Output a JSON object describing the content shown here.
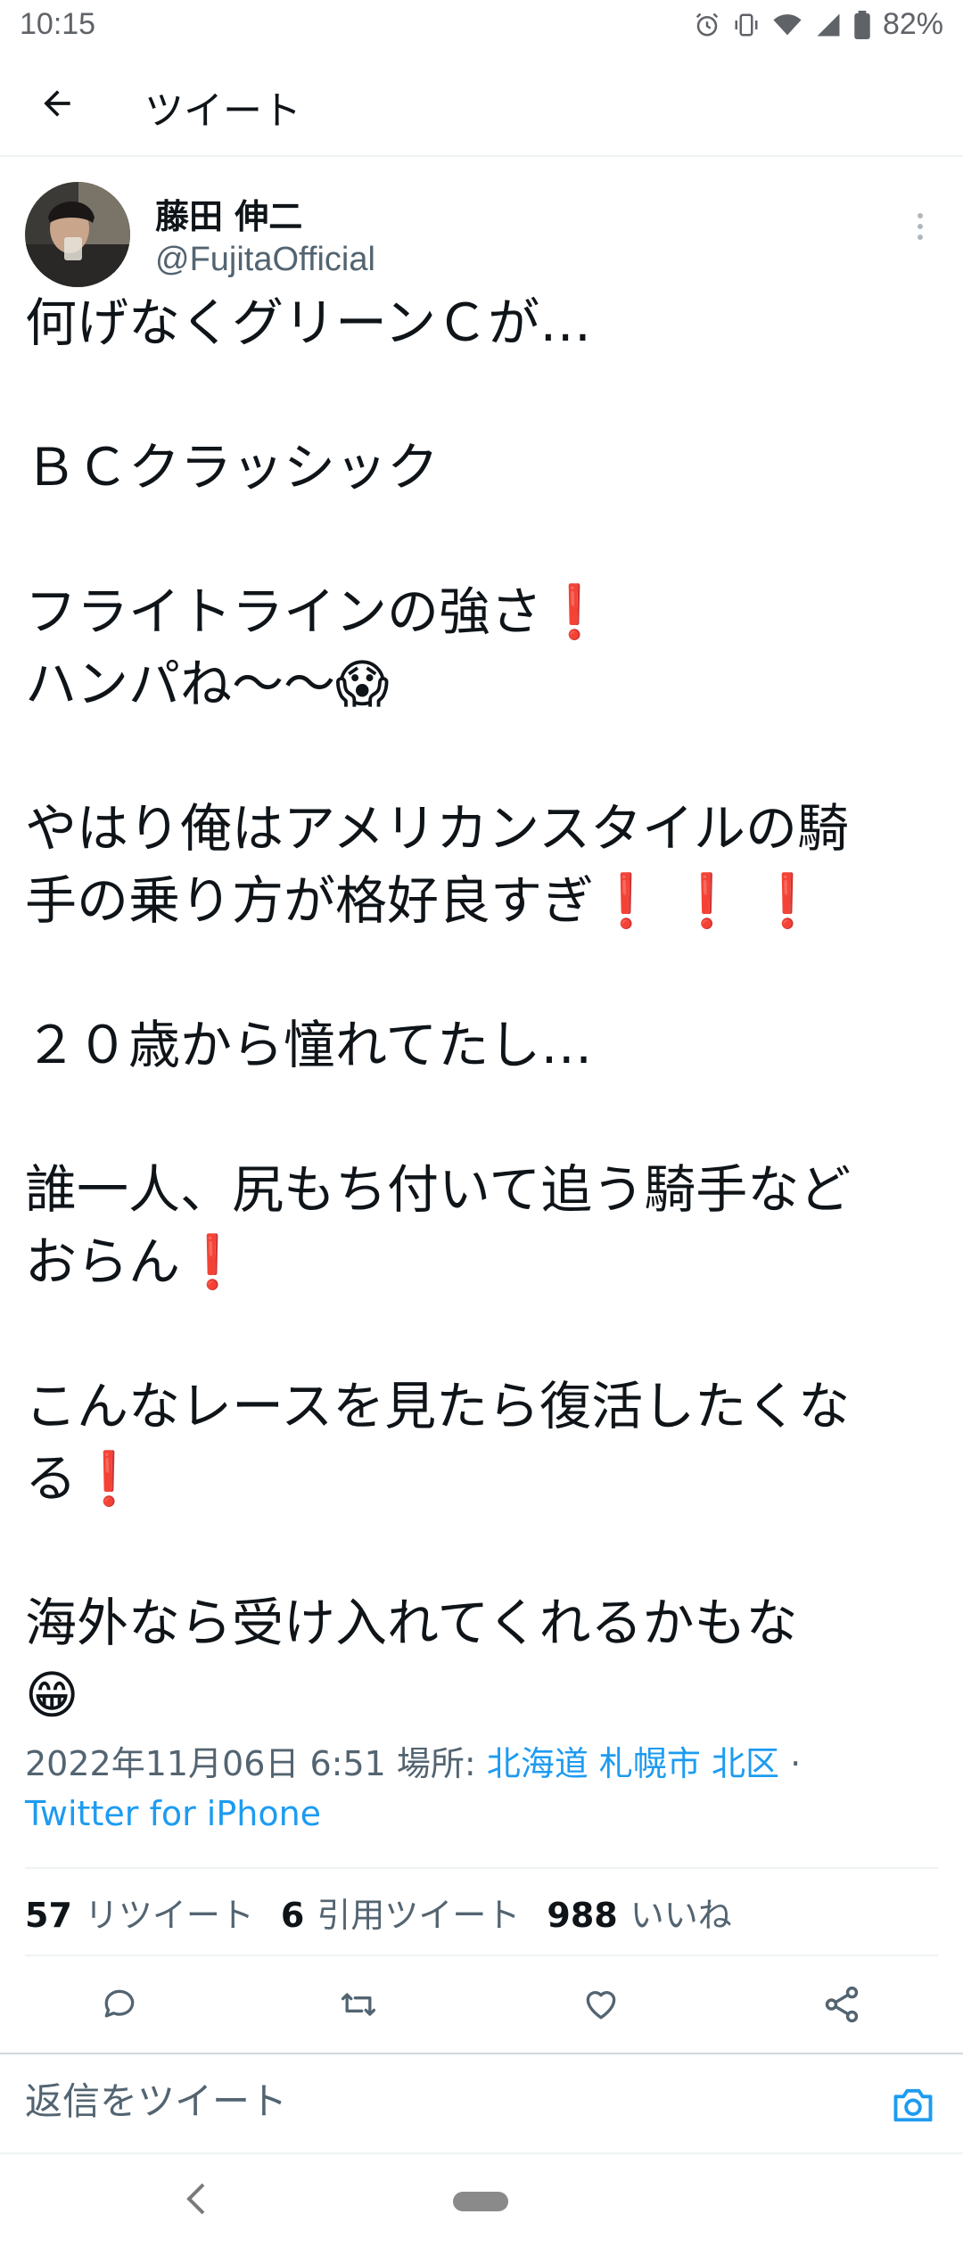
{
  "status_bar": {
    "time": "10:15",
    "battery": "82%"
  },
  "header": {
    "title": "ツイート"
  },
  "author": {
    "name": "藤田 伸二",
    "handle": "@FujitaOfficial"
  },
  "tweet": {
    "l1": "何げなくグリーンＣが…",
    "l2": "ＢＣクラッシック",
    "l3": "フライトラインの強さ",
    "l4": "ハンパね〜〜",
    "l5": "やはり俺はアメリカンスタイルの騎",
    "l6": "手の乗り方が格好良すぎ",
    "l7": "２０歳から憧れてたし…",
    "l8": "誰一人、尻もち付いて追う騎手など",
    "l9": "おらん",
    "l10": "こんなレースを見たら復活したくな",
    "l11": "る",
    "l12": "海外なら受け入れてくれるかもな",
    "excl": "❗",
    "emoji_scream": "😱",
    "emoji_grin": "😁"
  },
  "meta": {
    "datetime": "2022年11月06日 6:51",
    "location_label": "場所:",
    "location": "北海道 札幌市 北区",
    "separator": "·",
    "source": "Twitter for iPhone"
  },
  "stats": {
    "retweets_count": "57",
    "retweets_label": "リツイート",
    "quotes_count": "6",
    "quotes_label": "引用ツイート",
    "likes_count": "988",
    "likes_label": "いいね"
  },
  "reply": {
    "placeholder": "返信をツイート"
  },
  "colors": {
    "accent": "#1d9bf0",
    "text": "#0f1419",
    "secondary": "#536471",
    "exclamation": "#c4001a"
  }
}
